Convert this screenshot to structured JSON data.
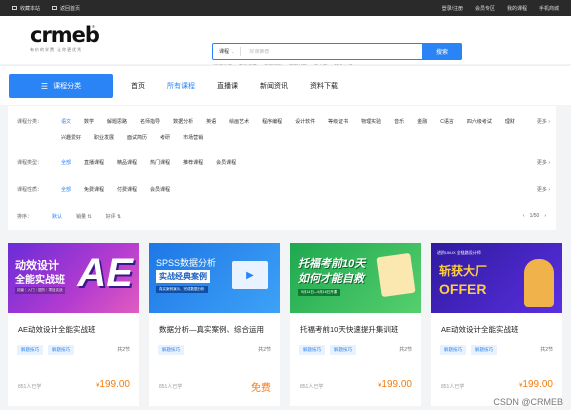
{
  "topbar": {
    "left": [
      "收藏本站",
      "返回首页"
    ],
    "right": [
      "登录/注册",
      "会员专区",
      "我的课程",
      "手机商城"
    ]
  },
  "logo": {
    "mark": "crmeb",
    "sub": "有价的学费 让你更优秀",
    "reg": "®"
  },
  "search": {
    "category": "课程",
    "placeholder": "好课推荐",
    "button": "搜索",
    "hot": [
      "知识付费",
      "软件商量",
      "物理课程",
      "面部试题",
      "静心篇",
      "软件入门"
    ]
  },
  "nav": {
    "category_button": "课程分类",
    "links": [
      "首页",
      "所有课程",
      "直播课",
      "新闻资讯",
      "资料下载"
    ],
    "active": 1
  },
  "filters": {
    "category": {
      "label": "课程分类：",
      "items": [
        "语文",
        "数学",
        "解题思路",
        "名师指导",
        "数据分析",
        "英语",
        "绘画艺术",
        "程序编程",
        "设计软件",
        "等级证书",
        "物理实验",
        "音乐",
        "金融",
        "C语言",
        "四六级考试",
        "理财",
        "兴趣爱好",
        "职业发展",
        "面试简历",
        "考研",
        "市场营销"
      ],
      "more": "更多"
    },
    "type": {
      "label": "课程类型：",
      "items": [
        "全部",
        "直播课程",
        "精品课程",
        "热门课程",
        "推荐课程",
        "会员课程"
      ],
      "more": "更多"
    },
    "price": {
      "label": "课程性质：",
      "items": [
        "全部",
        "免费课程",
        "付费课程",
        "会员课程"
      ],
      "more": "更多"
    }
  },
  "sort": {
    "label": "排序：",
    "items": [
      "默认",
      "销量",
      "好评"
    ],
    "page": "1/50"
  },
  "cards": [
    {
      "cover_big": "动效设计",
      "cover_line": "全能实战班",
      "cover_note": "初级｜入门｜进阶｜项目实战",
      "cover_ae": "AE",
      "title": "AE动效设计全能实战班",
      "tags": [
        "解题技巧",
        "解题技巧"
      ],
      "sections": "共2节",
      "learners": "851人已学",
      "price": "199.00",
      "currency": "¥",
      "accent": "#7a38e0"
    },
    {
      "cover_big": "SPSS数据分析",
      "cover_line": "实战经典案例",
      "cover_note": "真实案例演示，完成数据分析",
      "title": "数据分析—真实案例、综合运用",
      "tags": [
        "解题技巧"
      ],
      "sections": "共2节",
      "learners": "851人已学",
      "price": "免费",
      "currency": "",
      "accent": "#2b8af0"
    },
    {
      "cover_big": "托福考前10天",
      "cover_line": "如何才能自救",
      "cover_note": "9月14日—9月16日开课",
      "title": "托福考前10天快速提升集训班",
      "tags": [
        "解题技巧",
        "解题技巧"
      ],
      "sections": "共2节",
      "learners": "851人已学",
      "price": "199.00",
      "currency": "¥",
      "accent": "#23b35a"
    },
    {
      "cover_big": "斩获大厂",
      "cover_line": "OFFER",
      "cover_note": "进阶UI/UX 全链路设计师",
      "title": "AE动效设计全能实战班",
      "tags": [
        "解题技巧",
        "解题技巧"
      ],
      "sections": "共2节",
      "learners": "851人已学",
      "price": "199.00",
      "currency": "¥",
      "accent": "#4a24c4"
    }
  ],
  "watermark": "CSDN @CRMEB"
}
